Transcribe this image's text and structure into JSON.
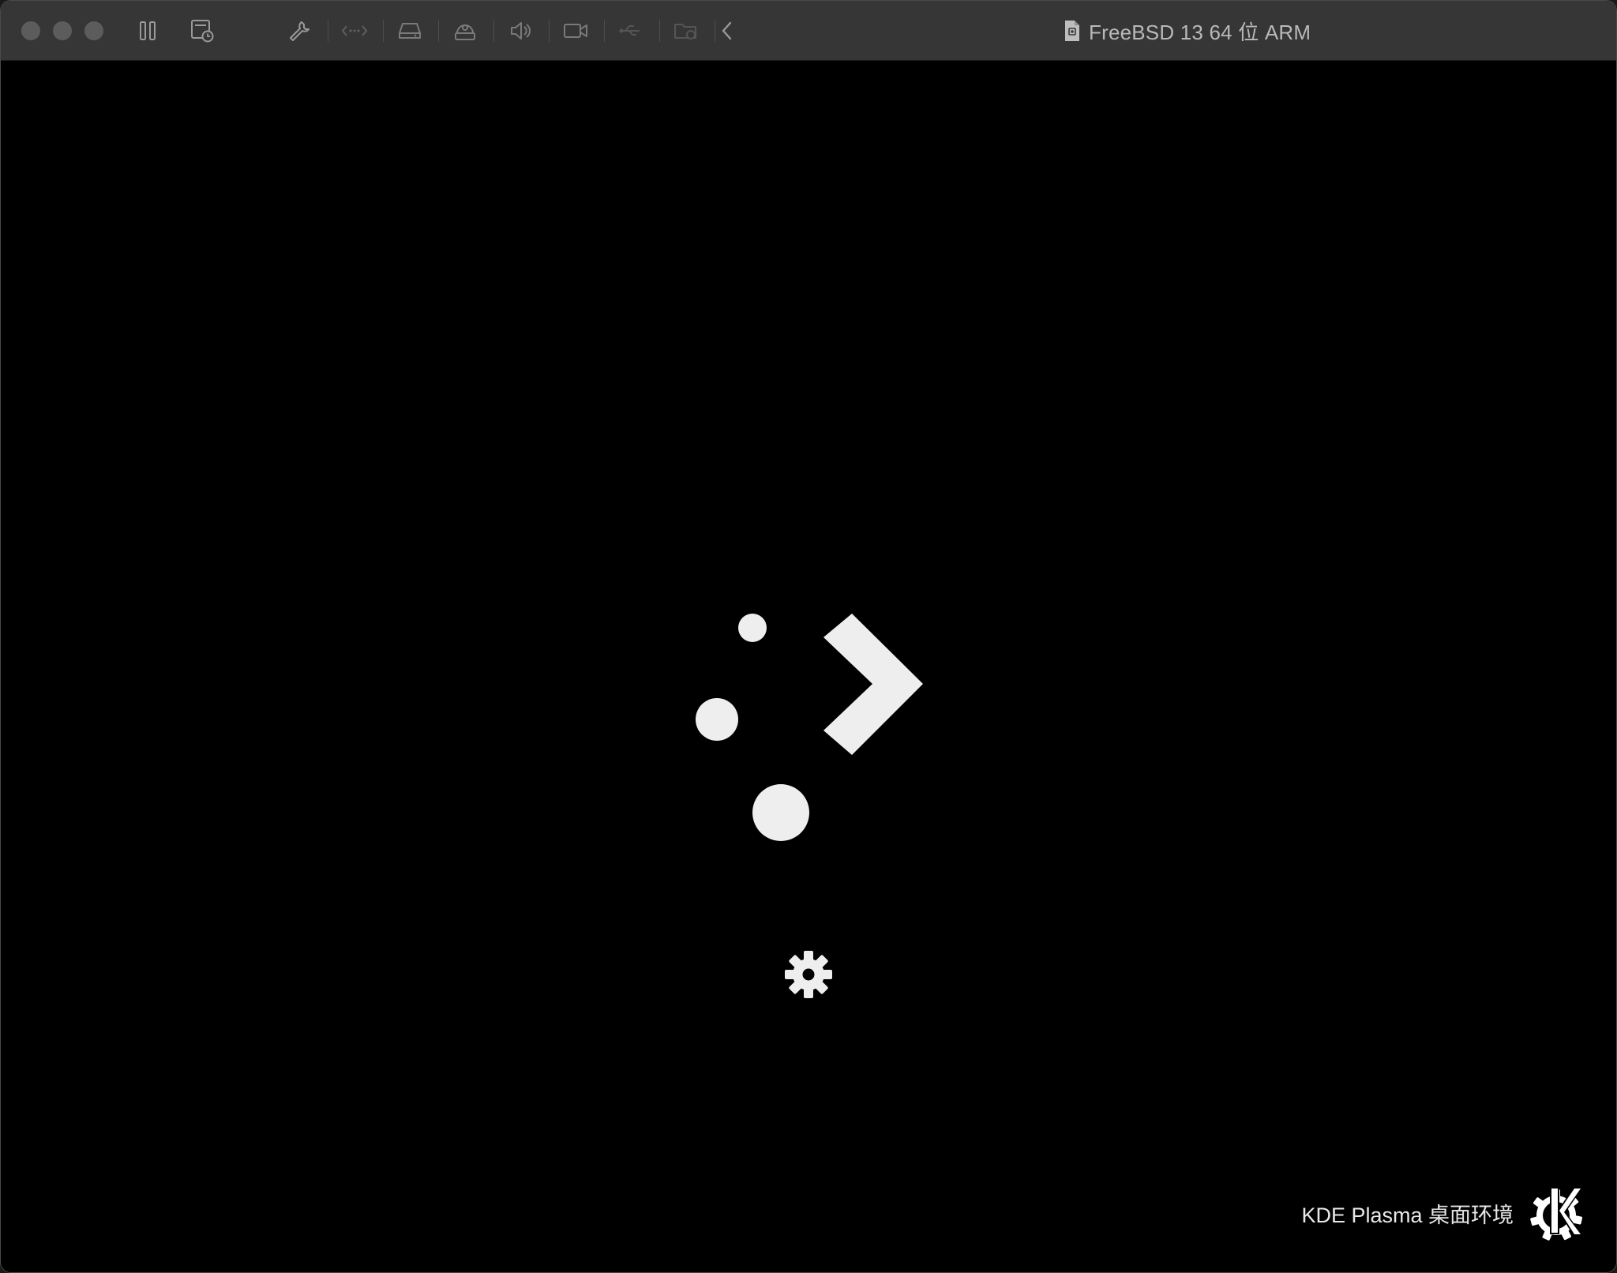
{
  "window": {
    "title": "FreeBSD 13 64 位 ARM",
    "toolbar": {
      "icons": [
        "pause-icon",
        "snapshot-icon",
        "settings-wrench-icon",
        "network-icon",
        "hard-disk-icon",
        "cd-dvd-icon",
        "sound-icon",
        "camera-icon",
        "usb-icon",
        "shared-folder-icon",
        "collapse-chevron-icon"
      ]
    }
  },
  "screen": {
    "splash": {
      "logo": "plasma-logo",
      "busy_indicator": "gear-icon"
    },
    "branding": {
      "text": "KDE Plasma 桌面环境",
      "logo": "kde-logo"
    }
  },
  "colors": {
    "titlebar": "#363636",
    "screen_bg": "#000000",
    "splash_fg": "#eeeeee"
  }
}
